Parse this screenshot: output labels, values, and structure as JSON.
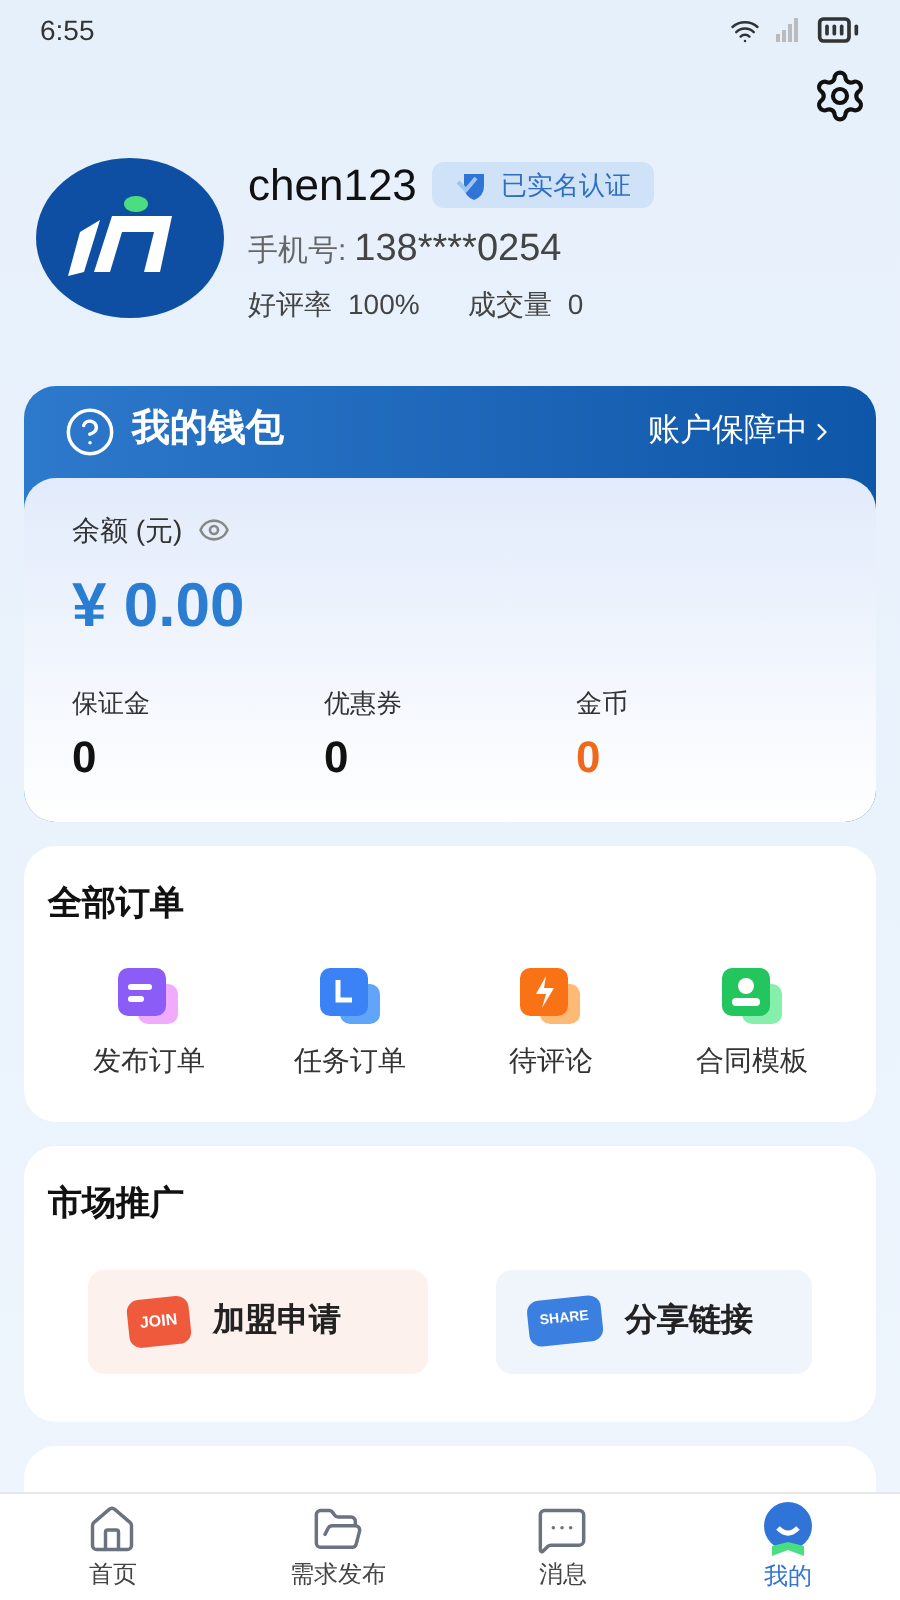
{
  "status_bar": {
    "time": "6:55"
  },
  "profile": {
    "username": "chen123",
    "verified_badge": "已实名认证",
    "phone_label": "手机号:",
    "phone": "138****0254",
    "rating_label": "好评率",
    "rating": "100%",
    "deals_label": "成交量",
    "deals": "0"
  },
  "wallet": {
    "title": "我的钱包",
    "protection": "账户保障中",
    "balance_label": "余额 (元)",
    "balance": "¥ 0.00",
    "stats": [
      {
        "label": "保证金",
        "value": "0",
        "highlight": false
      },
      {
        "label": "优惠券",
        "value": "0",
        "highlight": false
      },
      {
        "label": "金币",
        "value": "0",
        "highlight": true
      }
    ]
  },
  "orders": {
    "title": "全部订单",
    "items": [
      {
        "label": "发布订单",
        "kind": "publish"
      },
      {
        "label": "任务订单",
        "kind": "task"
      },
      {
        "label": "待评论",
        "kind": "review"
      },
      {
        "label": "合同模板",
        "kind": "contract"
      }
    ]
  },
  "promotion": {
    "title": "市场推广",
    "items": [
      {
        "label": "加盟申请",
        "badge": "JOIN",
        "kind": "join"
      },
      {
        "label": "分享链接",
        "badge": "SHARE",
        "kind": "share"
      }
    ]
  },
  "tab_bar": [
    {
      "label": "首页",
      "kind": "home",
      "selected": false
    },
    {
      "label": "需求发布",
      "kind": "folder",
      "selected": false
    },
    {
      "label": "消息",
      "kind": "message",
      "selected": false
    },
    {
      "label": "我的",
      "kind": "mine",
      "selected": true
    }
  ]
}
